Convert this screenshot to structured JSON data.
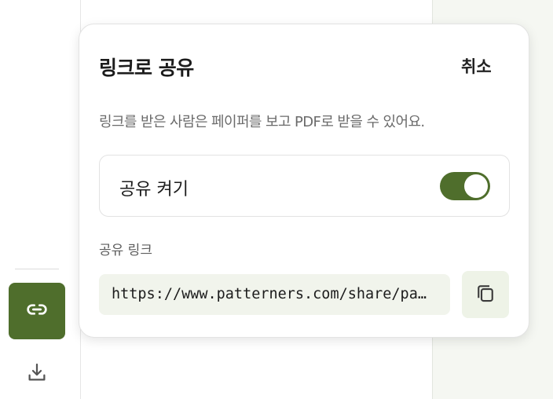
{
  "modal": {
    "title": "링크로 공유",
    "cancel_label": "취소",
    "description": "링크를 받은 사람은 페이퍼를 보고 PDF로 받을 수 있어요.",
    "toggle": {
      "label": "공유 켜기",
      "enabled": true
    },
    "share_link": {
      "label": "공유 링크",
      "url": "https://www.patterners.com/share/pa…"
    }
  },
  "rail": {
    "icons": [
      "link-icon",
      "download-icon"
    ]
  },
  "colors": {
    "accent": "#4f6e2c",
    "field_background": "#f1f4ec",
    "copy_button_background": "#eef3e7",
    "panel_background": "#f5f7f2"
  }
}
